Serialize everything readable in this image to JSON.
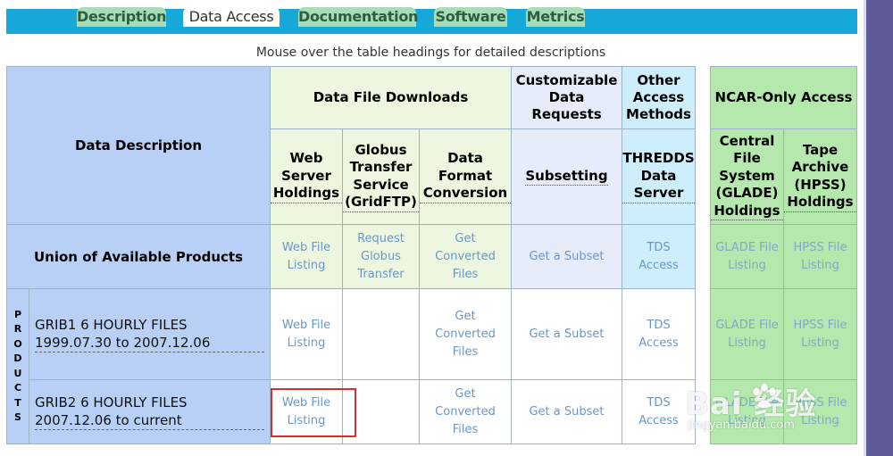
{
  "tabs": [
    {
      "label": "Description",
      "active": false
    },
    {
      "label": "Data Access",
      "active": true
    },
    {
      "label": "Documentation",
      "active": false
    },
    {
      "label": "Software",
      "active": false
    },
    {
      "label": "Metrics",
      "active": false
    }
  ],
  "hint": "Mouse over the table headings for detailed descriptions",
  "headers": {
    "data_description": "Data Description",
    "data_file_downloads": "Data File Downloads",
    "customizable": "Customizable Data Requests",
    "other_access": "Other Access Methods",
    "ncar_only": "NCAR-Only Access"
  },
  "subheaders": {
    "web_server": "Web Server Holdings",
    "globus": "Globus Transfer Service (GridFTP)",
    "format_conversion": "Data Format Conversion",
    "subsetting": "Subsetting",
    "thredds": "THREDDS Data Server",
    "glade": "Central File System (GLADE) Holdings",
    "hpss": "Tape Archive (HPSS) Holdings"
  },
  "products_vertical_label": "PRODUCTS",
  "rows": [
    {
      "label": "Union of Available Products",
      "web": "Web File Listing",
      "globus": "Request Globus Transfer",
      "convert": "Get Converted Files",
      "subset": "Get a Subset",
      "tds": "TDS Access",
      "glade": "GLADE File Listing",
      "hpss": "HPSS File Listing"
    },
    {
      "label": "GRIB1 6 HOURLY FILES 1999.07.30 to 2007.12.06",
      "web": "Web File Listing",
      "globus": "",
      "convert": "Get Converted Files",
      "subset": "Get a Subset",
      "tds": "TDS Access",
      "glade": "GLADE File Listing",
      "hpss": "HPSS File Listing"
    },
    {
      "label": "GRIB2 6 HOURLY FILES 2007.12.06 to current",
      "web": "Web File Listing",
      "globus": "",
      "convert": "Get Converted Files",
      "subset": "Get a Subset",
      "tds": "TDS Access",
      "glade": "GLADE File Listing",
      "hpss": "HPSS File Listing"
    }
  ],
  "watermark": {
    "brand": "Bai  经验",
    "url": "jingyan.baidu.com"
  },
  "colors": {
    "tab_bar": "#16a8d8",
    "tab": "#a8dcb4",
    "highlight": "#d43030",
    "link": "#6a97c8"
  }
}
